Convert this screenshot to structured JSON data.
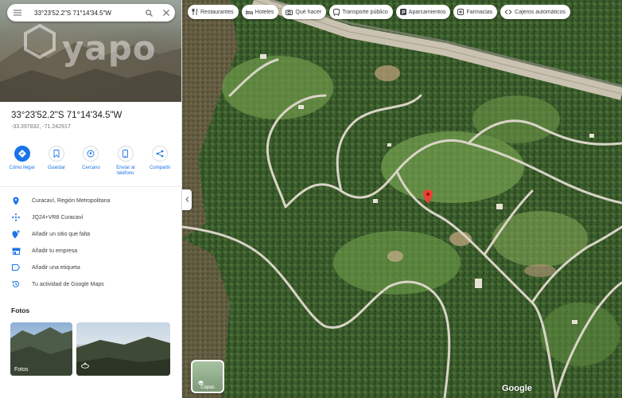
{
  "search": {
    "query": "33°23'52.2\"S 71°14'34.5\"W"
  },
  "watermark": {
    "text": "yapo"
  },
  "place": {
    "title": "33°23'52.2\"S 71°14'34.5\"W",
    "decimal": "-33.397832, -71.242917"
  },
  "actions": [
    {
      "label": "Cómo llegar",
      "icon": "directions-icon"
    },
    {
      "label": "Guardar",
      "icon": "bookmark-icon"
    },
    {
      "label": "Cercano",
      "icon": "nearby-icon"
    },
    {
      "label": "Enviar al teléfono",
      "icon": "phone-icon"
    },
    {
      "label": "Compartir",
      "icon": "share-icon"
    }
  ],
  "details": [
    {
      "text": "Curacaví, Región Metropolitana",
      "icon": "location-pin-icon"
    },
    {
      "text": "JQ24+VR8 Curacaví",
      "icon": "plus-code-icon"
    },
    {
      "text": "Añadir un sitio que falta",
      "icon": "add-place-icon"
    },
    {
      "text": "Añadir tu empresa",
      "icon": "business-icon"
    },
    {
      "text": "Añadir una etiqueta",
      "icon": "label-icon"
    },
    {
      "text": "Tu actividad de Google Maps",
      "icon": "history-icon"
    }
  ],
  "photos": {
    "title": "Fotos",
    "items": [
      {
        "label": "Fotos"
      },
      {
        "label": ""
      }
    ]
  },
  "chips": [
    {
      "label": "Restaurantes",
      "icon": "restaurant-icon"
    },
    {
      "label": "Hoteles",
      "icon": "hotel-icon"
    },
    {
      "label": "Qué hacer",
      "icon": "camera-icon"
    },
    {
      "label": "Transporte público",
      "icon": "transit-icon"
    },
    {
      "label": "Aparcamientos",
      "icon": "parking-icon"
    },
    {
      "label": "Farmacias",
      "icon": "pharmacy-icon"
    },
    {
      "label": "Cajeros automáticos",
      "icon": "atm-icon"
    }
  ],
  "layers": {
    "label": "Capas"
  },
  "map": {
    "attribution": "Google"
  },
  "colors": {
    "accent": "#1a73e8",
    "pin": "#ea4335"
  }
}
